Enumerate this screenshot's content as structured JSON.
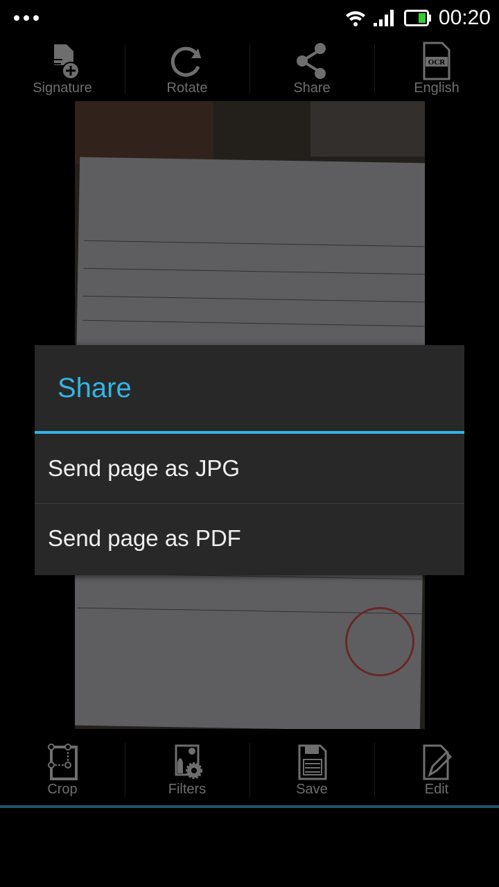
{
  "status_bar": {
    "time": "00:20",
    "battery_color": "#33cc33"
  },
  "top_toolbar": [
    {
      "label": "Signature",
      "icon": "signature-add-icon"
    },
    {
      "label": "Rotate",
      "icon": "rotate-icon"
    },
    {
      "label": "Share",
      "icon": "share-icon"
    },
    {
      "label": "English",
      "icon": "ocr-icon",
      "icon_text": "OCR"
    }
  ],
  "bottom_toolbar": [
    {
      "label": "Crop",
      "icon": "crop-icon"
    },
    {
      "label": "Filters",
      "icon": "filters-icon"
    },
    {
      "label": "Save",
      "icon": "save-icon"
    },
    {
      "label": "Edit",
      "icon": "edit-icon"
    }
  ],
  "dialog": {
    "title": "Share",
    "options": [
      "Send page as JPG",
      "Send page as PDF"
    ]
  },
  "colors": {
    "accent": "#33b5e5",
    "icon_gray": "#6e6e6e",
    "dialog_bg": "#282828"
  }
}
